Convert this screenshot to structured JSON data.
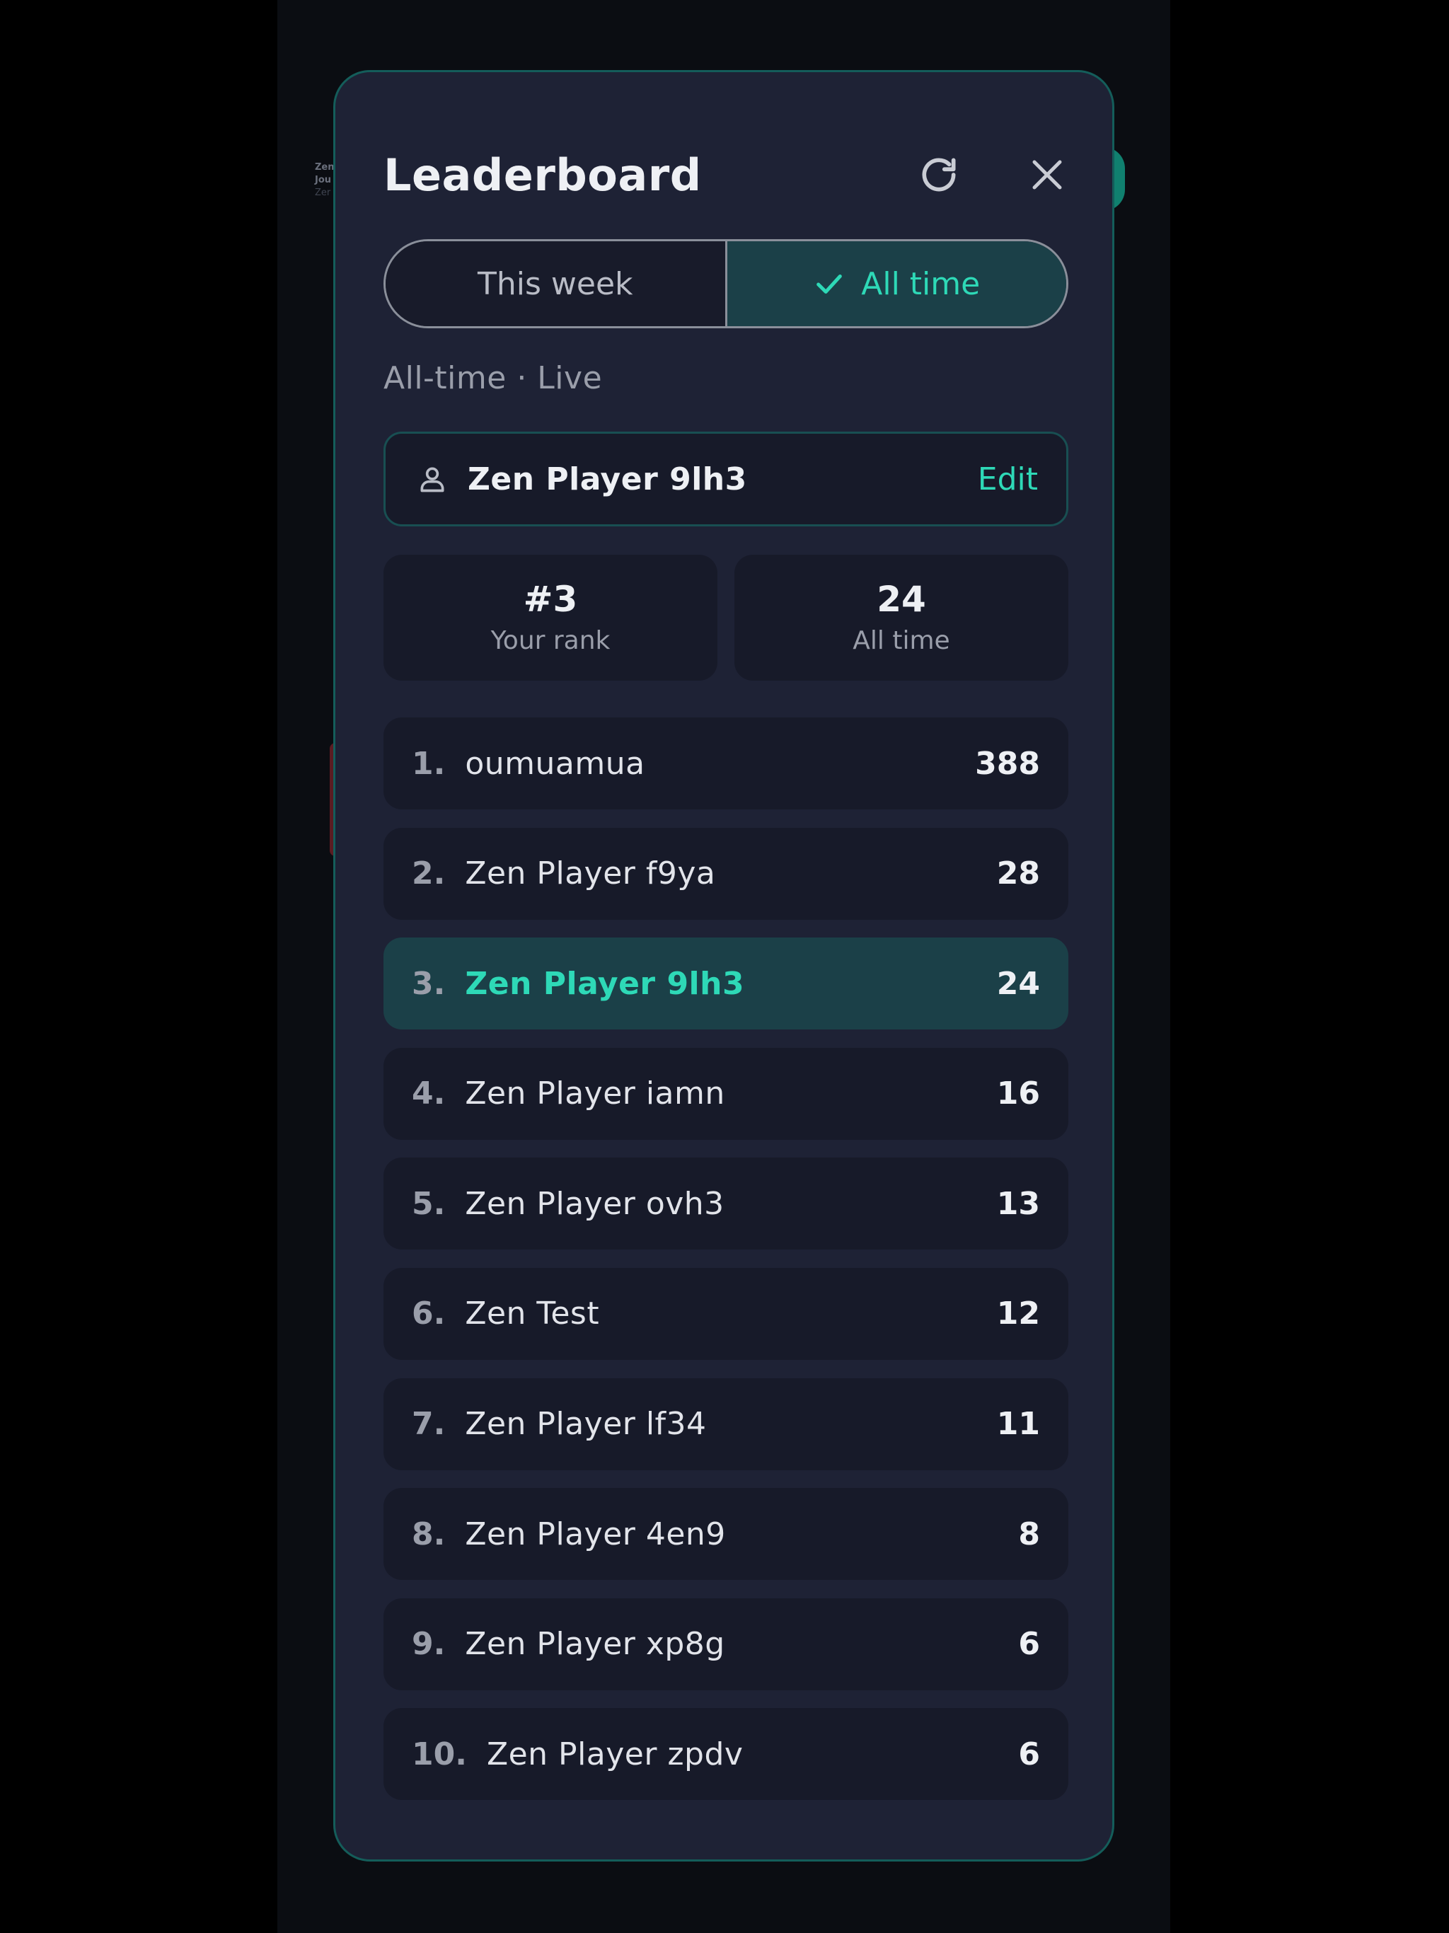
{
  "background": {
    "snippet_line1": "Zen",
    "snippet_line2": "Jou",
    "snippet_line3": "Zer"
  },
  "header": {
    "title": "Leaderboard",
    "refresh_icon": "refresh-icon",
    "close_icon": "close-icon"
  },
  "tabs": {
    "week_label": "This week",
    "alltime_label": "All time",
    "active": "All time"
  },
  "status_text": "All-time · Live",
  "player": {
    "name": "Zen Player 9lh3",
    "edit_label": "Edit"
  },
  "stats": {
    "rank_value": "#3",
    "rank_label": "Your rank",
    "score_value": "24",
    "score_label": "All time"
  },
  "leaderboard": [
    {
      "rank": "1.",
      "name": "oumuamua",
      "score": "388"
    },
    {
      "rank": "2.",
      "name": "Zen Player f9ya",
      "score": "28"
    },
    {
      "rank": "3.",
      "name": "Zen Player 9lh3",
      "score": "24",
      "is_me": true
    },
    {
      "rank": "4.",
      "name": "Zen Player iamn",
      "score": "16"
    },
    {
      "rank": "5.",
      "name": "Zen Player ovh3",
      "score": "13"
    },
    {
      "rank": "6.",
      "name": "Zen Test",
      "score": "12"
    },
    {
      "rank": "7.",
      "name": "Zen Player lf34",
      "score": "11"
    },
    {
      "rank": "8.",
      "name": "Zen Player 4en9",
      "score": "8"
    },
    {
      "rank": "9.",
      "name": "Zen Player xp8g",
      "score": "6"
    },
    {
      "rank": "10.",
      "name": "Zen Player zpdv",
      "score": "6"
    }
  ],
  "colors": {
    "accent": "#2ed9b7",
    "modal_bg": "#1e2235",
    "card_bg": "#171a29",
    "highlight_bg": "#1b4048"
  }
}
